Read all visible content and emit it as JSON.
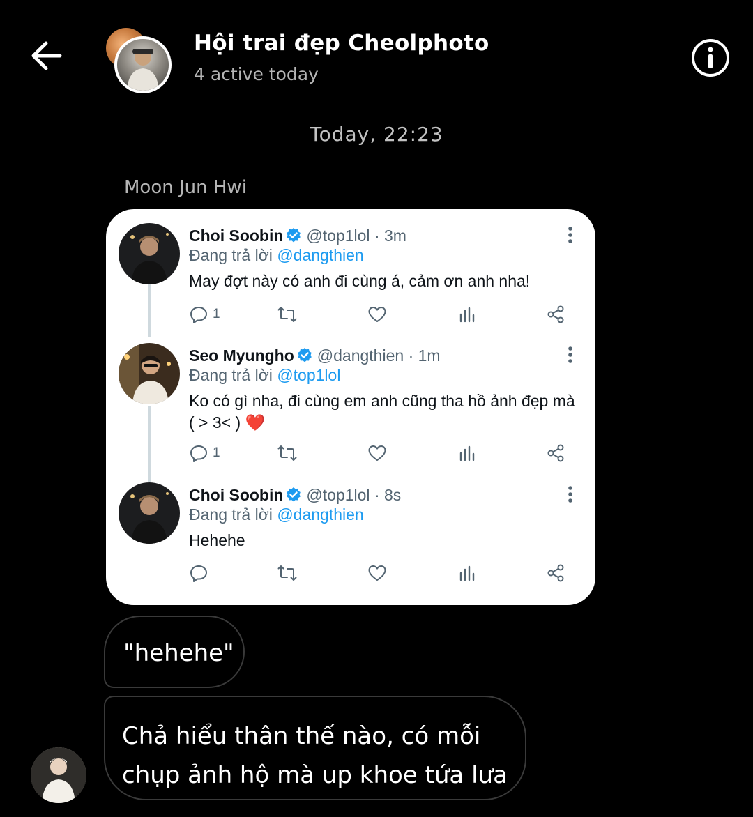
{
  "header": {
    "title": "Hội trai đẹp Cheolphoto",
    "subtitle": "4 active today"
  },
  "timestamp": "Today, 22:23",
  "sender_name": "Moon Jun Hwi",
  "shared_card": {
    "tweets": [
      {
        "name": "Choi Soobin",
        "handle": "@top1lol",
        "time": "· 3m",
        "reply_prefix": "Đang trả lời",
        "reply_to": "@dangthien",
        "text": "May đợt này có anh đi cùng á, cảm ơn anh nha!",
        "reply_count": "1"
      },
      {
        "name": "Seo Myungho",
        "handle": "@dangthien",
        "time": "· 1m",
        "reply_prefix": "Đang trả lời",
        "reply_to": "@top1lol",
        "text": "Ko có gì nha, đi cùng em anh cũng tha hồ ảnh đẹp mà (  > 3< ) ❤️",
        "reply_count": "1"
      },
      {
        "name": "Choi Soobin",
        "handle": "@top1lol",
        "time": "· 8s",
        "reply_prefix": "Đang trả lời",
        "reply_to": "@dangthien",
        "text": "Hehehe",
        "reply_count": ""
      }
    ]
  },
  "messages": [
    {
      "text": "\"hehehe\""
    },
    {
      "text": "Chả hiểu thân thế nào, có mỗi chụp ảnh hộ mà up khoe tứa lưa"
    }
  ],
  "colors": {
    "background": "#000000",
    "link_blue": "#1d9bf0",
    "verified_blue": "#1d9bf0",
    "muted_text": "#536471"
  },
  "icons": [
    "back-arrow-icon",
    "info-icon",
    "verified-badge-icon",
    "more-vertical-icon",
    "reply-icon",
    "retweet-icon",
    "like-icon",
    "analytics-icon",
    "share-icon"
  ]
}
